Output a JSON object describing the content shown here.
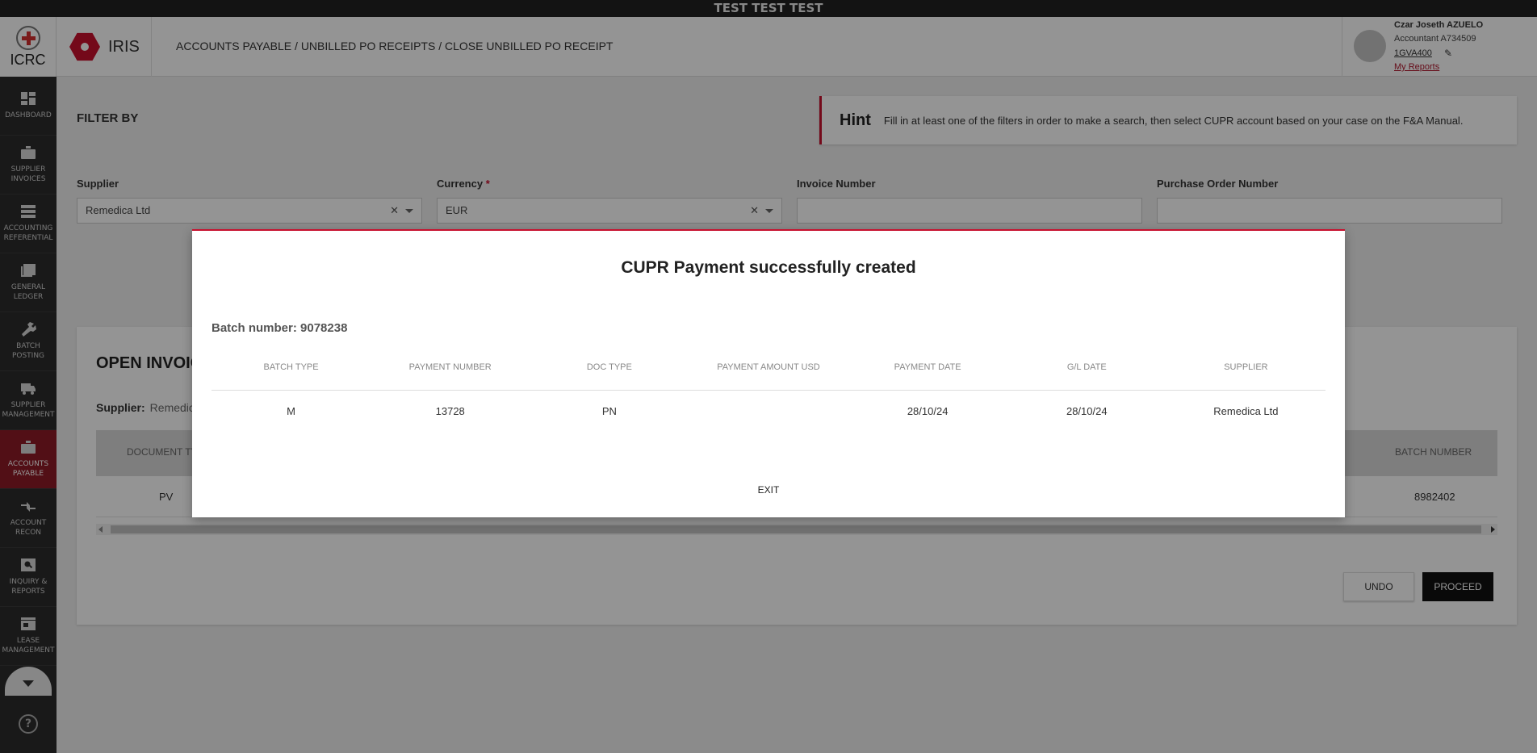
{
  "env_banner": "TEST TEST TEST",
  "logo": {
    "text": "ICRC"
  },
  "sidebar": {
    "items": [
      {
        "label": "DASHBOARD",
        "icon": "dashboard-icon"
      },
      {
        "label": "SUPPLIER INVOICES",
        "icon": "briefcase-icon"
      },
      {
        "label": "ACCOUNTING REFERENTIAL",
        "icon": "list-icon"
      },
      {
        "label": "GENERAL LEDGER",
        "icon": "ledger-icon"
      },
      {
        "label": "BATCH POSTING",
        "icon": "wrench-icon"
      },
      {
        "label": "SUPPLIER MANAGEMENT",
        "icon": "truck-icon"
      },
      {
        "label": "ACCOUNTS PAYABLE",
        "icon": "briefcase-icon",
        "active": true
      },
      {
        "label": "ACCOUNT RECON",
        "icon": "arrows-icon"
      },
      {
        "label": "INQUIRY & REPORTS",
        "icon": "search-icon"
      },
      {
        "label": "LEASE MANAGEMENT",
        "icon": "store-icon"
      }
    ]
  },
  "app": {
    "name": "IRIS"
  },
  "breadcrumb": "ACCOUNTS PAYABLE / UNBILLED PO RECEIPTS / CLOSE UNBILLED PO RECEIPT",
  "user": {
    "name": "Czar Joseth AZUELO",
    "role": "Accountant A734509",
    "code": "1GVA400",
    "reports_link": "My Reports"
  },
  "filter": {
    "title": "FILTER BY",
    "hint_title": "Hint",
    "hint_text": "Fill in at least one of the filters in order to make a search, then select CUPR account based on your case on the F&A Manual.",
    "supplier_label": "Supplier",
    "supplier_value": "Remedica Ltd",
    "currency_label": "Currency",
    "currency_required": "*",
    "currency_value": "EUR",
    "invoice_label": "Invoice Number",
    "invoice_value": "",
    "po_label": "Purchase Order Number",
    "po_value": ""
  },
  "results": {
    "title": "OPEN INVOIC",
    "supplier_label": "Supplier:",
    "supplier_value": "Remedic",
    "col_document_type": "DOCUMENT TY",
    "col_batch_number": "BATCH NUMBER",
    "row_document_type": "PV",
    "row_batch_number": "8982402",
    "undo_label": "UNDO",
    "proceed_label": "PROCEED"
  },
  "modal": {
    "title": "CUPR Payment successfully created",
    "batch_text": "Batch number: 9078238",
    "columns": [
      "BATCH TYPE",
      "PAYMENT NUMBER",
      "DOC TYPE",
      "PAYMENT AMOUNT USD",
      "PAYMENT DATE",
      "G/L DATE",
      "SUPPLIER"
    ],
    "rows": [
      [
        "M",
        "13728",
        "PN",
        "",
        "28/10/24",
        "28/10/24",
        "Remedica Ltd"
      ]
    ],
    "exit_label": "EXIT"
  }
}
